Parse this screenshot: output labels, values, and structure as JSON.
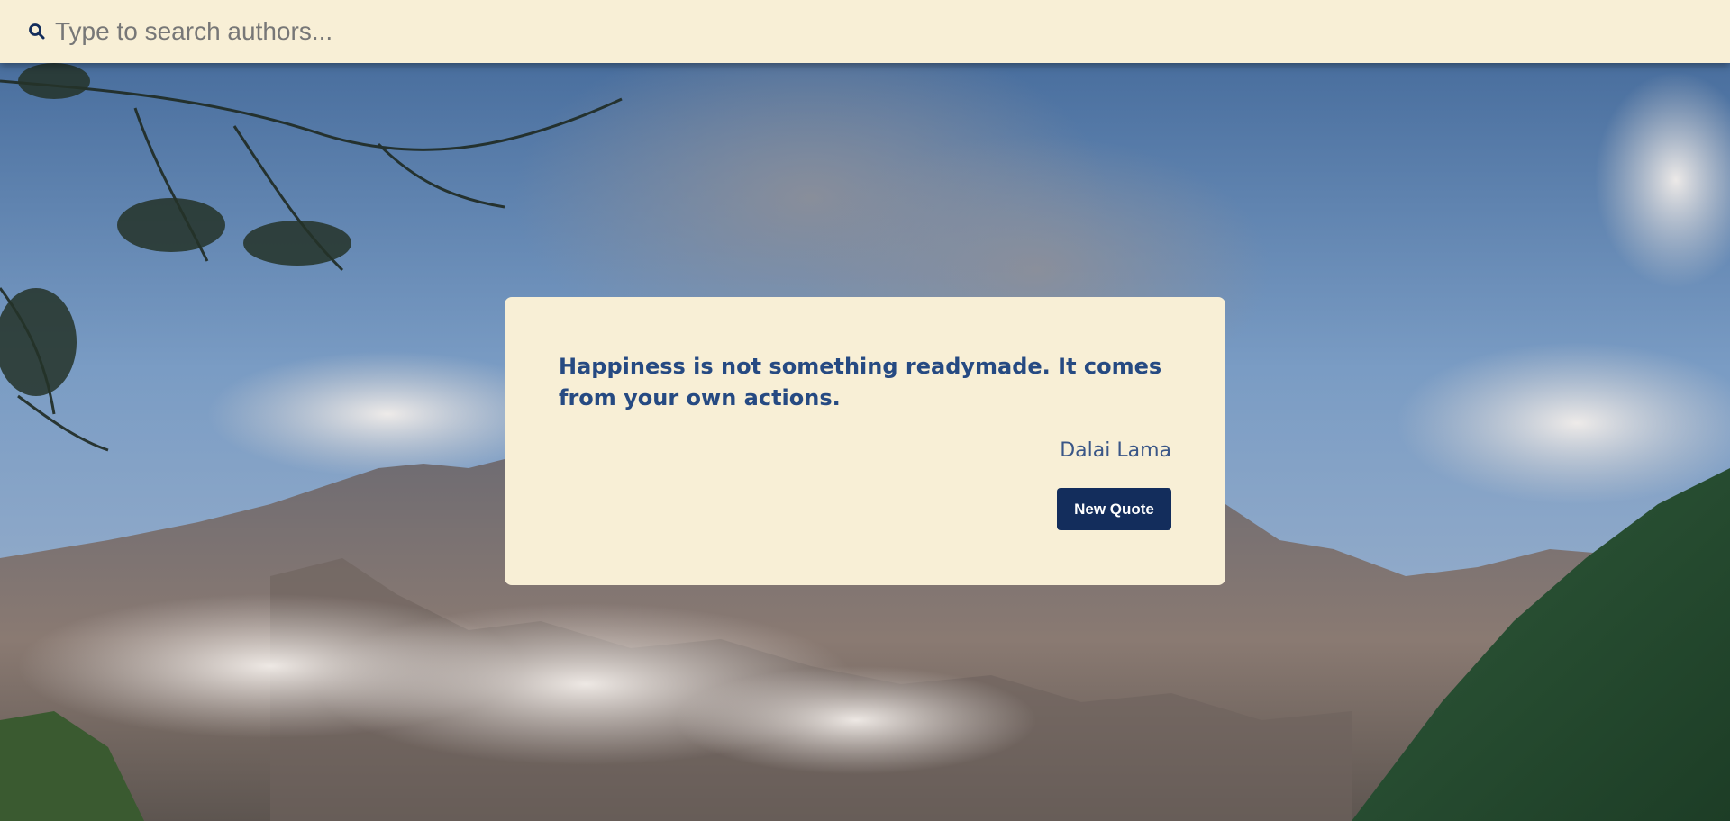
{
  "search": {
    "placeholder": "Type to search authors...",
    "value": ""
  },
  "quote": {
    "text": "Happiness is not something readymade. It comes from your own actions.",
    "author": "Dalai Lama",
    "button_label": "New Quote"
  },
  "colors": {
    "panel_background": "#f8efd6",
    "quote_text": "#264a82",
    "button_background": "#132d5c",
    "button_text": "#ffffff"
  },
  "icons": {
    "search": "search-icon"
  }
}
